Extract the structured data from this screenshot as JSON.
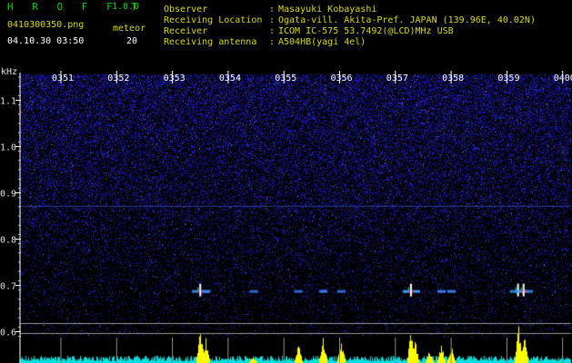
{
  "app": {
    "name": "H R O F F T",
    "version": "1.0.0"
  },
  "file": {
    "name": "0410300350.png",
    "timestamp": "04.10.30 03:50"
  },
  "meteor": {
    "label": "meteor",
    "count": "20"
  },
  "info": [
    {
      "label": "Observer",
      "value": "Masayuki Kobayashi"
    },
    {
      "label": "Receiving Location",
      "value": "Ogata-vill. Akita-Pref. JAPAN (139.96E, 40.02N)"
    },
    {
      "label": "Receiver",
      "value": "ICOM IC-575 53.7492(@LCD)MHz USB"
    },
    {
      "label": "Receiving antenna",
      "value": "A504HB(yagi 4el)"
    }
  ],
  "separator": ":",
  "axis": {
    "unit": "kHz",
    "time_ticks": [
      "0351",
      "0352",
      "0353",
      "0354",
      "0355",
      "0356",
      "0357",
      "0358",
      "0359",
      "0400"
    ],
    "freq_ticks": [
      "1.1",
      "1.0",
      "0.9",
      "0.8",
      "0.7",
      "0.6"
    ]
  },
  "colors": {
    "noise": "#1a1aa0",
    "grid": "#9a9a9a",
    "line": "#3040a0",
    "histogram": "#ffff00",
    "noise_floor": "#00e0e0",
    "label": "#dcdc00",
    "app": "#00d800"
  },
  "echoes_minutes": [
    3.5,
    3.6,
    4.45,
    5.25,
    5.7,
    6.02,
    7.28,
    7.82,
    8.0,
    9.2,
    9.3
  ]
}
